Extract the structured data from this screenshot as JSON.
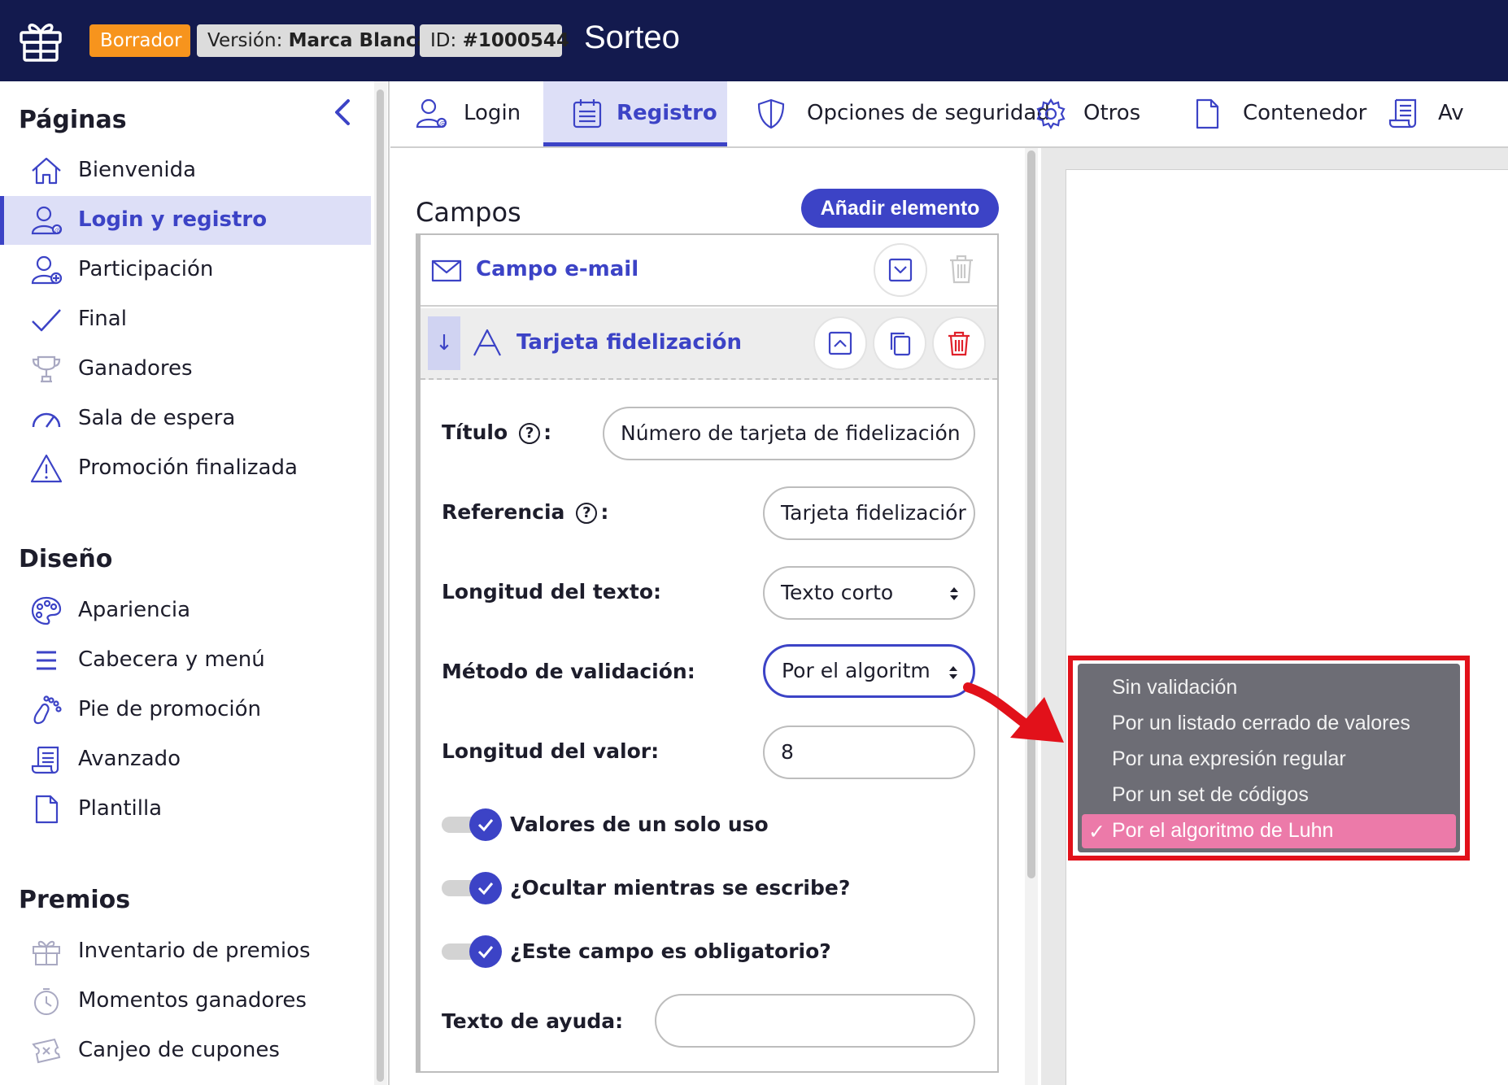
{
  "topbar": {
    "logo_icon": "gift-icon",
    "badge_draft": "Borrador",
    "badge_version_prefix": "Versión:",
    "badge_version_value": "Marca Blanca",
    "badge_id_prefix": "ID:",
    "badge_id_value": "#1000544",
    "app_title": "Sorteo"
  },
  "sidebar": {
    "section_pages": "Páginas",
    "section_design": "Diseño",
    "section_prizes": "Premios",
    "pages": [
      {
        "label": "Bienvenida",
        "icon": "home-icon"
      },
      {
        "label": "Login y registro",
        "icon": "user-at-icon",
        "active": true
      },
      {
        "label": "Participación",
        "icon": "user-plus-icon"
      },
      {
        "label": "Final",
        "icon": "checkmark-icon"
      },
      {
        "label": "Ganadores",
        "icon": "trophy-icon"
      },
      {
        "label": "Sala de espera",
        "icon": "gauge-icon"
      },
      {
        "label": "Promoción finalizada",
        "icon": "warning-icon"
      }
    ],
    "design": [
      {
        "label": "Apariencia",
        "icon": "palette-icon"
      },
      {
        "label": "Cabecera y menú",
        "icon": "menu-icon"
      },
      {
        "label": "Pie de promoción",
        "icon": "footprint-icon"
      },
      {
        "label": "Avanzado",
        "icon": "scroll-icon"
      },
      {
        "label": "Plantilla",
        "icon": "file-icon"
      }
    ],
    "prizes": [
      {
        "label": "Inventario de premios",
        "icon": "gift-icon"
      },
      {
        "label": "Momentos ganadores",
        "icon": "clock-icon"
      },
      {
        "label": "Canjeo de cupones",
        "icon": "coupon-icon"
      }
    ]
  },
  "tabs": [
    {
      "label": "Login",
      "icon": "user-at-icon"
    },
    {
      "label": "Registro",
      "icon": "calendar-list-icon",
      "active": true
    },
    {
      "label": "Opciones de seguridad",
      "icon": "shield-icon"
    },
    {
      "label": "Otros",
      "icon": "gear-icon"
    },
    {
      "label": "Contenedor",
      "icon": "file-icon"
    },
    {
      "label": "Av",
      "icon": "scroll-icon"
    }
  ],
  "fields_panel": {
    "title": "Campos",
    "add_button": "Añadir elemento",
    "email_field_label": "Campo e-mail",
    "card_field_label": "Tarjeta fidelización",
    "drag_glyph": "↓",
    "form": {
      "title_label": "Título",
      "title_value": "Número de tarjeta de fidelización",
      "reference_label": "Referencia",
      "reference_value": "Tarjeta fidelizaciór",
      "text_length_label": "Longitud del texto:",
      "text_length_value": "Texto corto",
      "validation_label": "Método de validación:",
      "validation_value": "Por el algoritm",
      "value_length_label": "Longitud del valor:",
      "value_length_value": "8",
      "toggle_single_use": "Valores de un solo uso",
      "toggle_hide_typing": "¿Ocultar mientras se escribe?",
      "toggle_required": "¿Este campo es obligatorio?",
      "help_text_label": "Texto de ayuda:",
      "help_text_value": "",
      "help_glyph": "?",
      "colon": ":"
    }
  },
  "dropdown": {
    "options": [
      "Sin validación",
      "Por un listado cerrado de valores",
      "Por una expresión regular",
      "Por un set de códigos",
      "Por el algoritmo de Luhn"
    ],
    "selected_index": 4,
    "check_glyph": "✓"
  },
  "colors": {
    "topbar": "#131a4e",
    "accent": "#3c43c6",
    "draft_badge": "#f7941d",
    "highlight_frame": "#e2111a",
    "selected_option": "#ec7aa9"
  }
}
